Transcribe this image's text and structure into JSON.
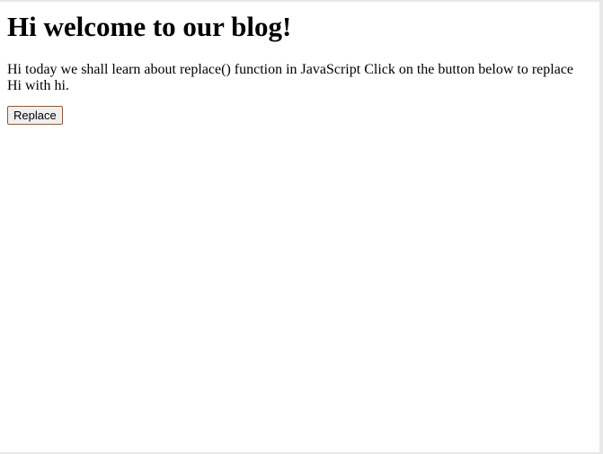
{
  "page": {
    "heading": "Hi welcome to our blog!",
    "paragraph": "Hi today we shall learn about replace() function in JavaScript Click on the button below to replace Hi with hi.",
    "button_label": "Replace"
  },
  "colors": {
    "background": "#ffffff",
    "text": "#000000",
    "button_background": "#efefef",
    "button_border": "#8f5a3c"
  }
}
